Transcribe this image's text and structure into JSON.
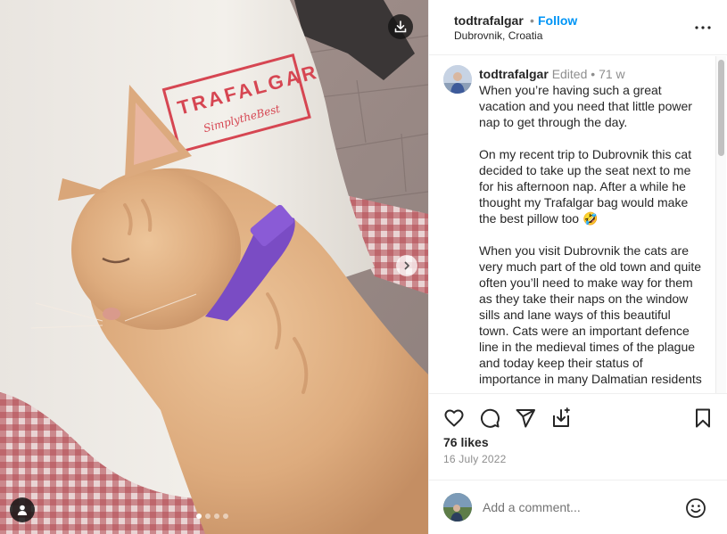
{
  "post": {
    "username": "todtrafalgar",
    "separator": "•",
    "follow_label": "Follow",
    "location": "Dubrovnik, Croatia"
  },
  "photo": {
    "bag_brand": "TRAFALGAR",
    "bag_slogan": "SimplytheBest",
    "carousel_count": 4,
    "carousel_active": 1,
    "icons": [
      "download-icon",
      "chevron-right-icon",
      "user-tag-icon"
    ]
  },
  "caption": {
    "username": "todtrafalgar",
    "edited": "Edited",
    "separator": "•",
    "age": "71 w",
    "text": "When you’re having such a great vacation and you need that little power nap to get through the day.\n\nOn my recent trip to Dubrovnik this cat decided to take up the seat next to me for his afternoon nap. After a while he thought my Trafalgar bag would make the best pillow too 🤣\n\nWhen you visit Dubrovnik the cats are very much part of the old town and quite often you’ll need to make way for them as they take their naps on the window sills and lane ways of this beautiful town. Cats were an important defence line in the medieval times of the plague and today keep their status of importance in many Dalmatian residents"
  },
  "actions": {
    "icons": [
      "heart-icon",
      "comment-icon",
      "share-icon",
      "save-to-collection-icon",
      "bookmark-icon"
    ]
  },
  "likes": "76 likes",
  "date": "16 July 2022",
  "comment_box": {
    "placeholder": "Add a comment..."
  },
  "colors": {
    "accent": "#0095f6",
    "text": "#262626",
    "secondary": "#8e8e8e",
    "border": "#efefef"
  }
}
